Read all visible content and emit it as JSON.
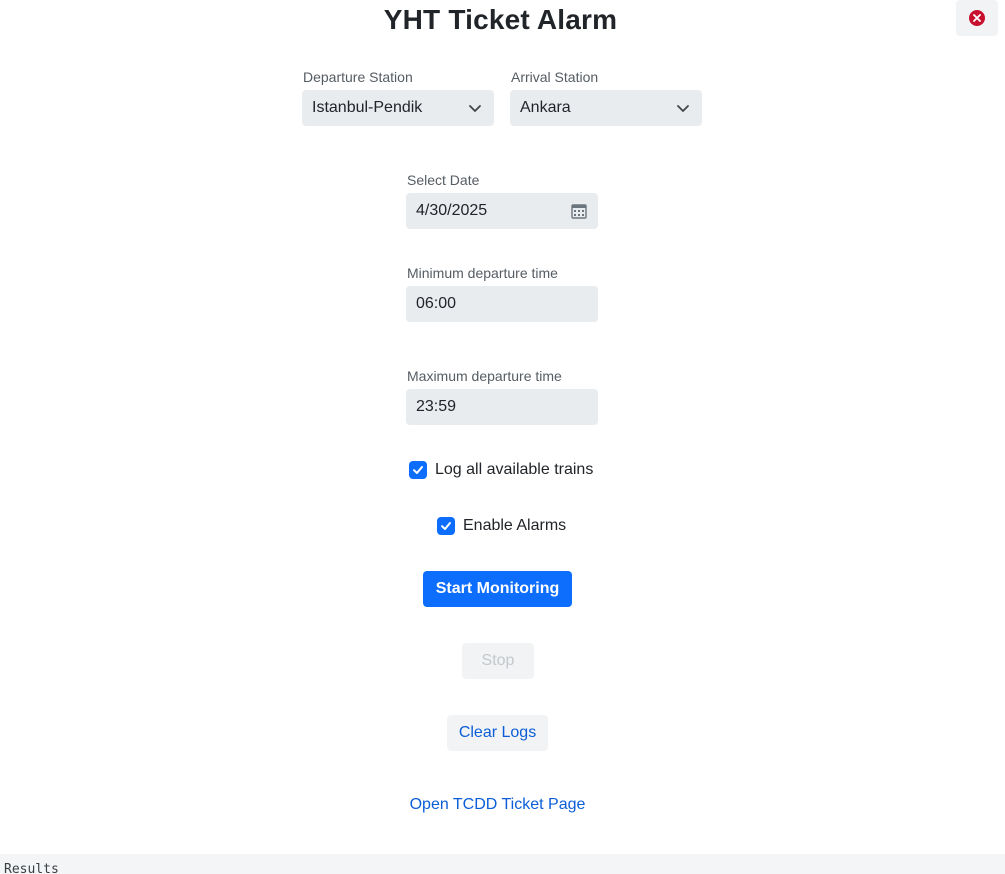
{
  "app": {
    "title": "YHT Ticket Alarm"
  },
  "form": {
    "departure_label": "Departure Station",
    "departure_value": "Istanbul-Pendik",
    "arrival_label": "Arrival Station",
    "arrival_value": "Ankara",
    "date_label": "Select Date",
    "date_value": "4/30/2025",
    "min_time_label": "Minimum departure time",
    "min_time_value": "06:00",
    "max_time_label": "Maximum departure time",
    "max_time_value": "23:59",
    "log_all_label": "Log all available trains",
    "log_all_checked": true,
    "enable_alarms_label": "Enable Alarms",
    "enable_alarms_checked": true
  },
  "actions": {
    "start_label": "Start Monitoring",
    "stop_label": "Stop",
    "stop_disabled": true,
    "clear_label": "Clear Logs",
    "open_tcdd_label": "Open TCDD Ticket Page"
  },
  "results": {
    "label": "Results"
  },
  "colors": {
    "accent": "#0d6efd",
    "close": "#c8102e",
    "field_bg": "#e9ecef"
  },
  "icons": {
    "close": "x-circle-icon",
    "select": "chevron-down-icon",
    "date": "calendar-icon",
    "check": "check-icon"
  }
}
